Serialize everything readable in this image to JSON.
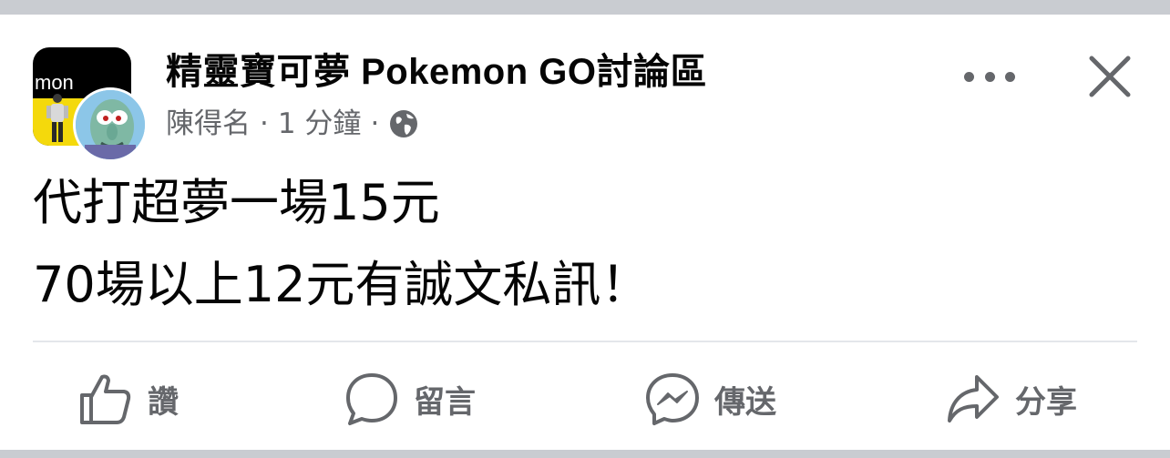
{
  "post": {
    "group_name": "精靈寶可夢 Pokemon GO討論區",
    "author": "陳得名",
    "separator": "·",
    "time": "1 分鐘",
    "group_avatar_text": "mon",
    "lines": [
      "代打超夢一場15元",
      "70場以上12元有誠文私訊！"
    ]
  },
  "icons": {
    "more": "more-options-icon",
    "close": "close-icon",
    "privacy": "globe-icon",
    "like": "thumbs-up-icon",
    "comment": "speech-bubble-icon",
    "send": "messenger-icon",
    "share": "share-arrow-icon"
  },
  "actions": {
    "like": "讚",
    "comment": "留言",
    "send": "傳送",
    "share": "分享"
  },
  "colors": {
    "background": "#c9ccd1",
    "card": "#ffffff",
    "text": "#050505",
    "secondary_text": "#65676b",
    "divider": "#e4e6eb",
    "group_avatar_yellow": "#f4d90c"
  }
}
